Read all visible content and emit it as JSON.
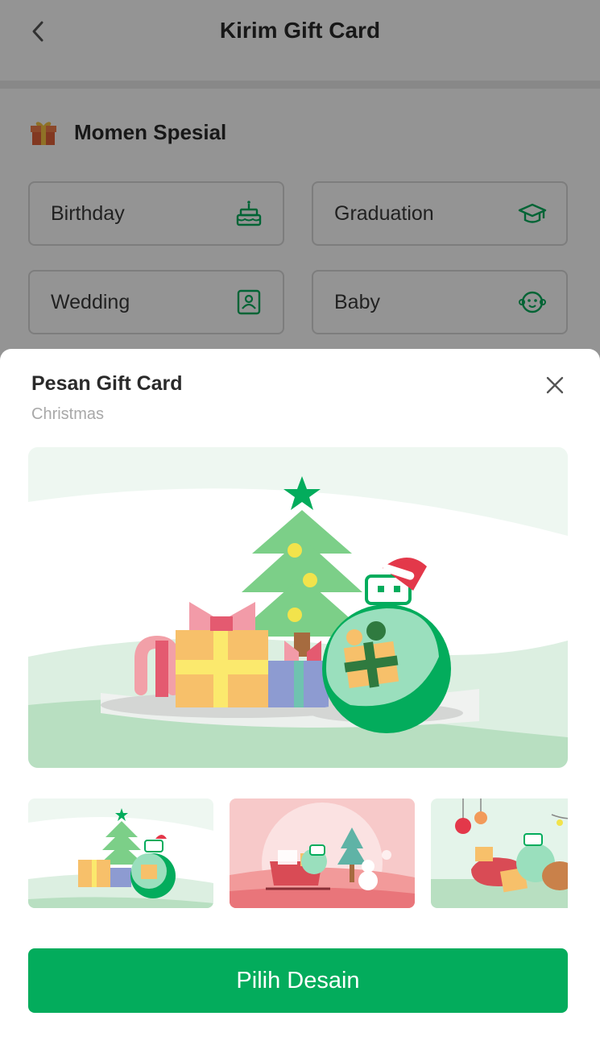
{
  "header": {
    "title": "Kirim Gift Card",
    "back_icon": "chevron-left-icon"
  },
  "section": {
    "icon": "gift-box-icon",
    "title": "Momen Spesial"
  },
  "occasions": [
    {
      "label": "Birthday",
      "icon": "cake-icon"
    },
    {
      "label": "Graduation",
      "icon": "graduation-cap-icon"
    },
    {
      "label": "Wedding",
      "icon": "wedding-photo-icon"
    },
    {
      "label": "Baby",
      "icon": "baby-face-icon"
    }
  ],
  "sheet": {
    "title": "Pesan Gift Card",
    "subtitle": "Christmas",
    "close_icon": "close-icon",
    "main_preview": "christmas-tree-gifts-illustration",
    "thumbnails": [
      "christmas-tree-gifts-thumbnail",
      "christmas-sleigh-snowman-thumbnail",
      "christmas-ornaments-gifts-thumbnail"
    ],
    "button_label": "Pilih Desain"
  },
  "colors": {
    "brand_green": "#03ac5c",
    "overlay": "rgba(0,0,0,0.42)",
    "border": "#d8d8d8",
    "subtitle_grey": "#a8a8a8"
  }
}
